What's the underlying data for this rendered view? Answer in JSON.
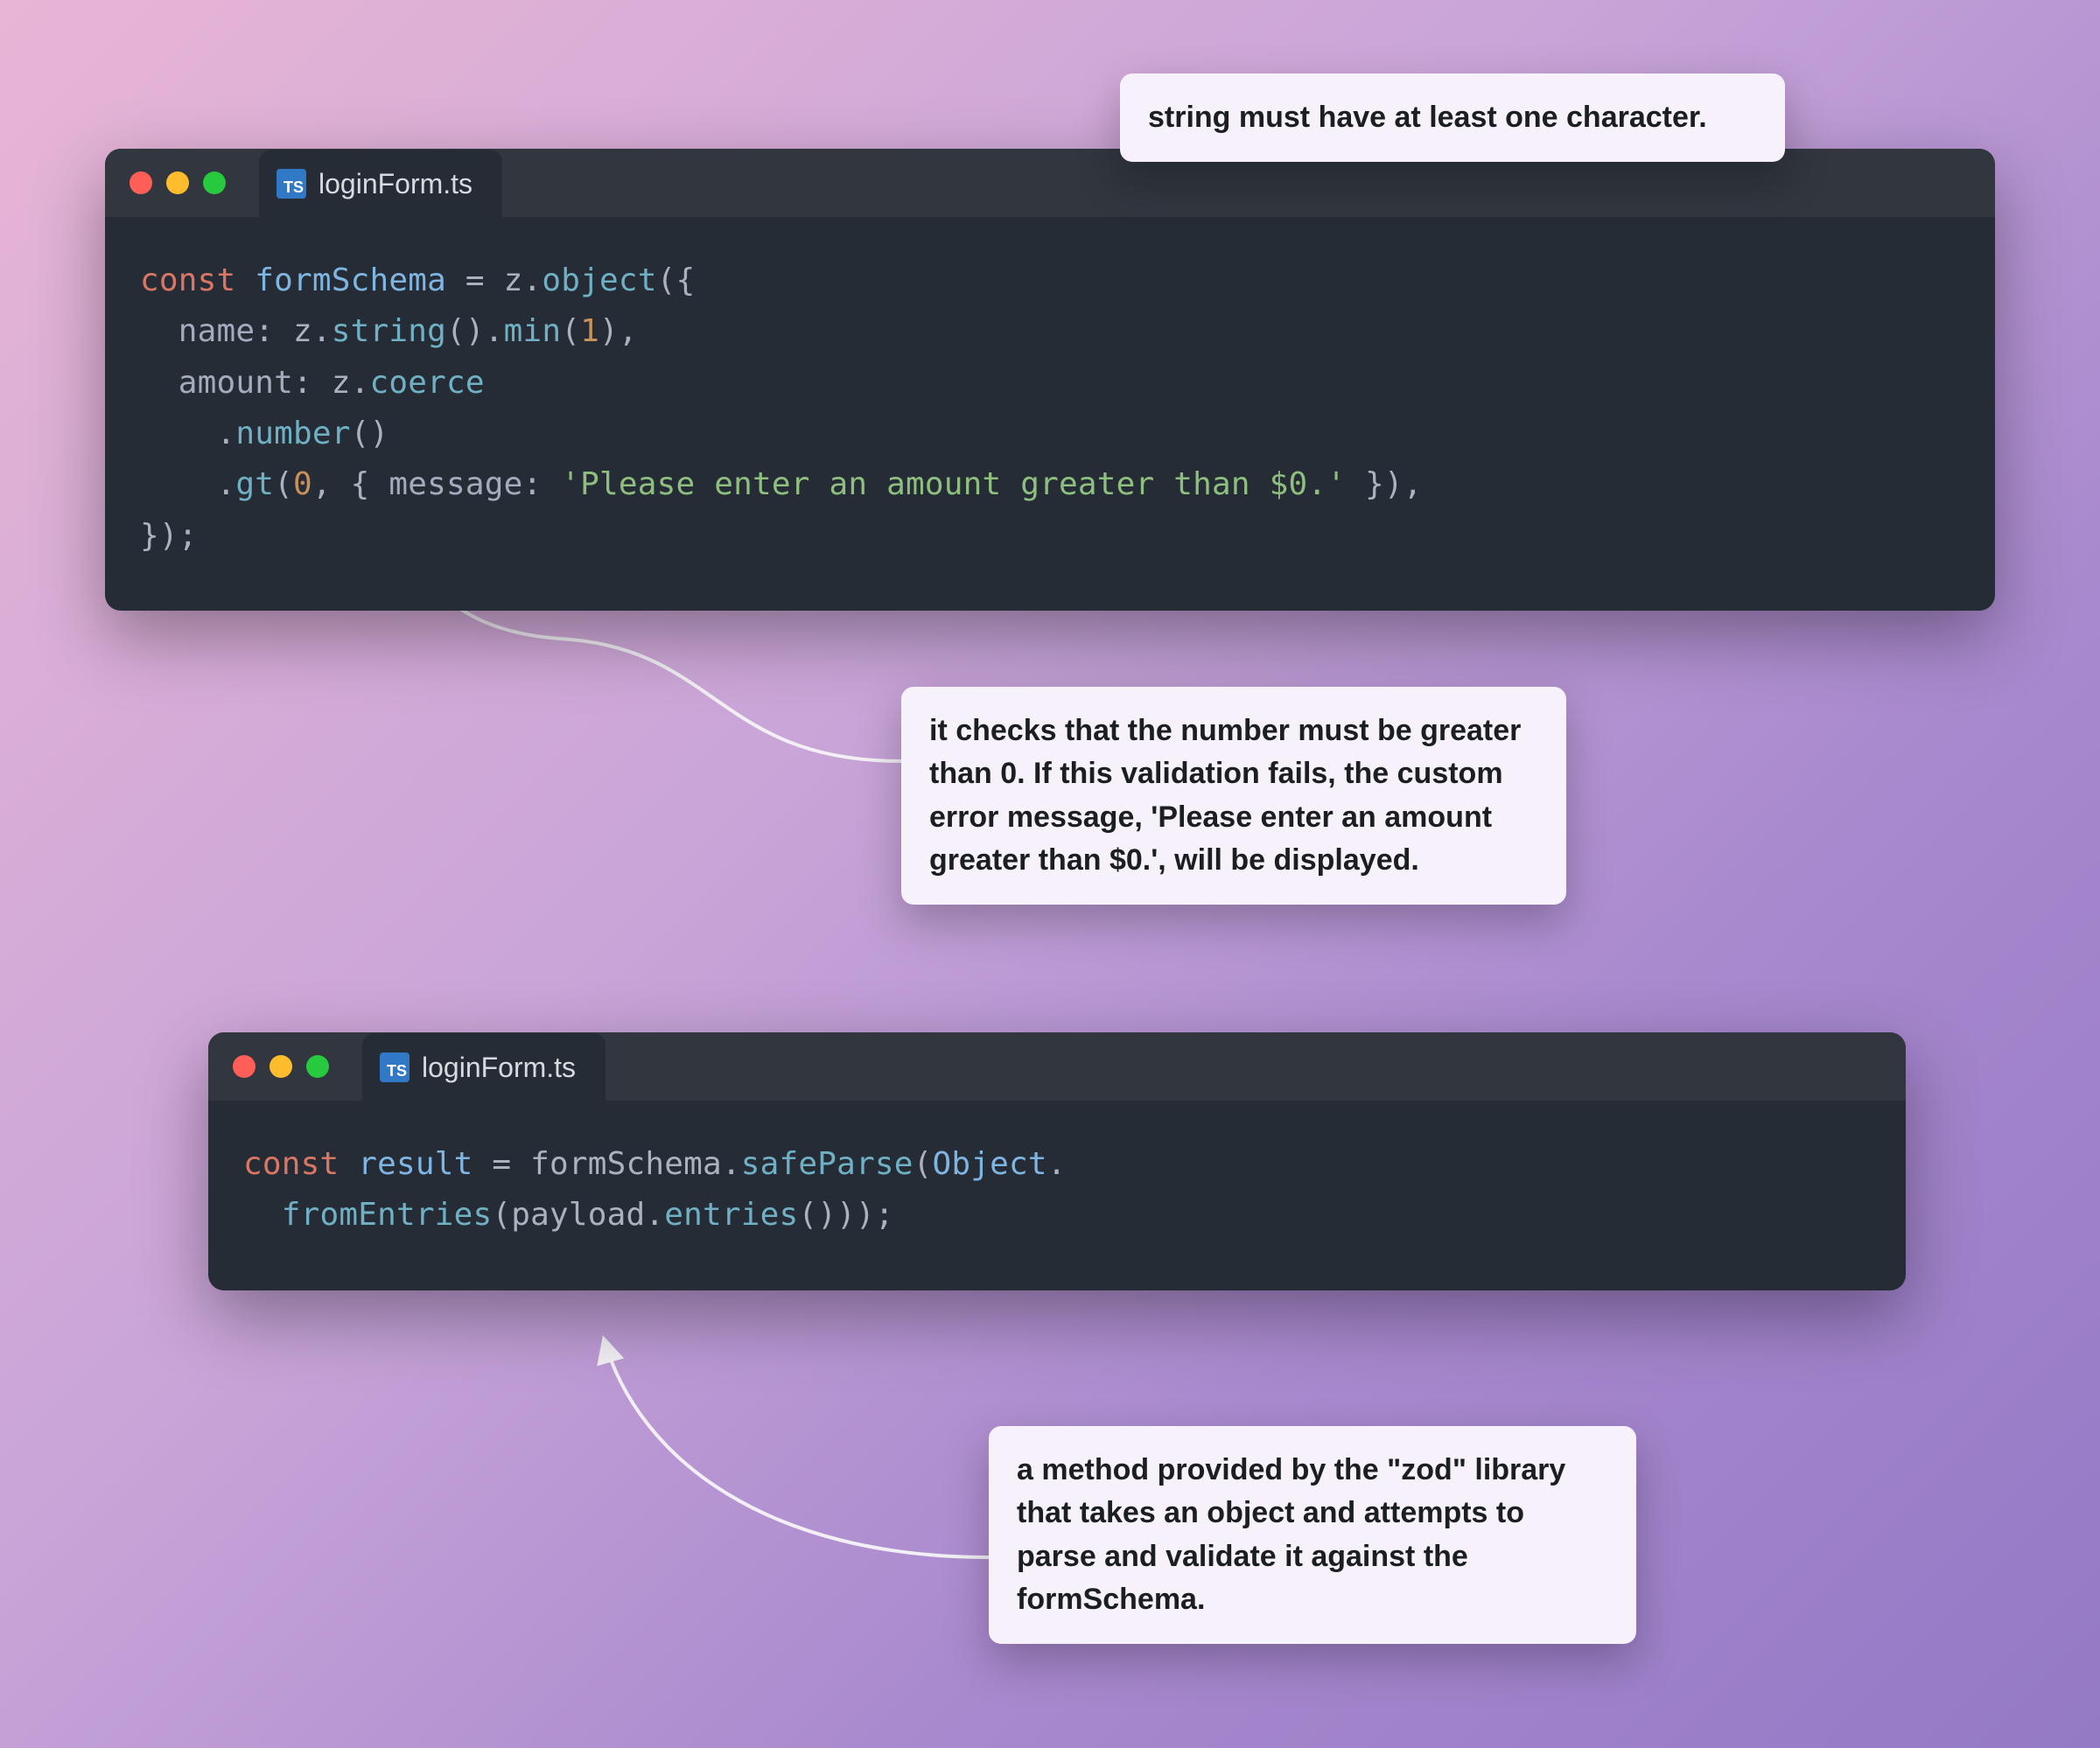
{
  "windows": {
    "top": {
      "filename": "loginForm.ts",
      "code": {
        "l1_kw": "const",
        "l1_ident": "formSchema",
        "l1_eq": " = z.",
        "l1_object": "object",
        "l1_open": "({",
        "l2_indent": "  ",
        "l2_key": "name",
        "l2_colon": ": z.",
        "l2_string": "string",
        "l2_paren": "().",
        "l2_min": "min",
        "l2_open": "(",
        "l2_num": "1",
        "l2_close": "),",
        "l3_indent": "  ",
        "l3_key": "amount",
        "l3_colon": ": z.",
        "l3_coerce": "coerce",
        "l4_indent": "    .",
        "l4_number": "number",
        "l4_paren": "()",
        "l5_indent": "    .",
        "l5_gt": "gt",
        "l5_open": "(",
        "l5_num": "0",
        "l5_comma": ", { ",
        "l5_msgkey": "message",
        "l5_colon": ": ",
        "l5_str": "'Please enter an amount greater than $0.'",
        "l5_close": " }),",
        "l6": "});"
      }
    },
    "bottom": {
      "filename": "loginForm.ts",
      "code": {
        "l1_kw": "const",
        "l1_ident": "result",
        "l1_eq": " = formSchema.",
        "l1_safeparse": "safeParse",
        "l1_open": "(",
        "l1_object": "Object",
        "l1_dot": ".",
        "l2_indent": "  ",
        "l2_from": "fromEntries",
        "l2_open": "(payload.",
        "l2_entries": "entries",
        "l2_close": "()));"
      }
    }
  },
  "callouts": {
    "c1": "string must have at least one character.",
    "c2": "it checks that the number must be greater than 0. If this validation fails, the custom error message, 'Please enter an amount greater than $0.', will be displayed.",
    "c3": "a method provided by the \"zod\" library that takes an object and attempts to parse and validate it against the formSchema."
  }
}
